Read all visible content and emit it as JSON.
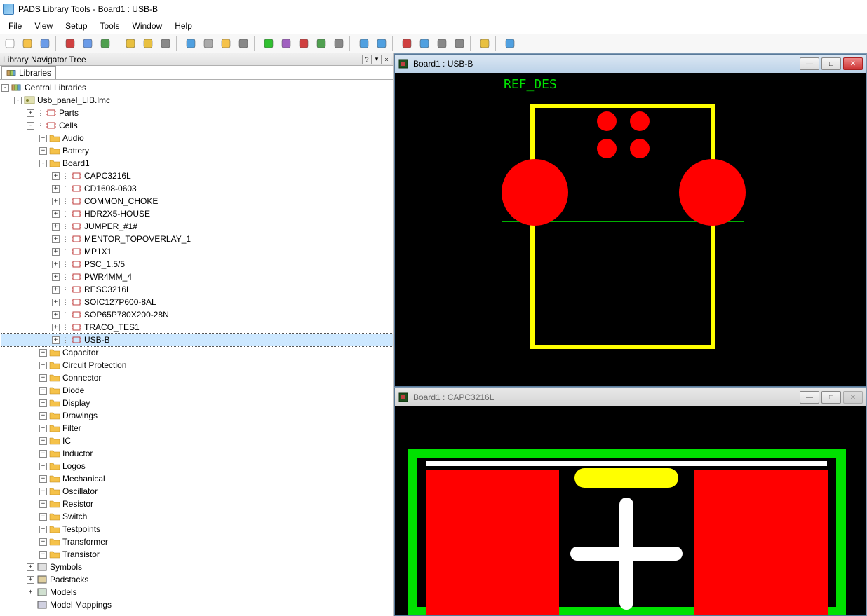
{
  "window_title": "PADS Library Tools - Board1 : USB-B",
  "menu": [
    "File",
    "View",
    "Setup",
    "Tools",
    "Window",
    "Help"
  ],
  "toolbar_icons": [
    "new",
    "open",
    "save",
    "sep",
    "prop-grid",
    "prop-text",
    "numeric",
    "sep",
    "edit-yellow",
    "edit-multi",
    "gear",
    "sep",
    "db-blue",
    "wrench",
    "stack",
    "grid",
    "sep",
    "green-circle",
    "purple",
    "db-red",
    "comp",
    "db-wrench",
    "sep",
    "undo",
    "redo",
    "sep",
    "window-red",
    "window-blue",
    "split",
    "cascade",
    "sep",
    "filter",
    "sep",
    "help"
  ],
  "panel_title": "Library Navigator Tree",
  "panel_controls": [
    "?",
    "▾",
    "×"
  ],
  "tab_label": "Libraries",
  "tree": {
    "root": "Central Libraries",
    "lib": "Usb_panel_LIB.lmc",
    "parts": "Parts",
    "cells": "Cells",
    "cell_folders_before": [
      "Audio",
      "Battery"
    ],
    "board1": "Board1",
    "board1_cells": [
      "CAPC3216L",
      "CD1608-0603",
      "COMMON_CHOKE",
      "HDR2X5-HOUSE",
      "JUMPER_#1#",
      "MENTOR_TOPOVERLAY_1",
      "MP1X1",
      "PSC_1.5/5",
      "PWR4MM_4",
      "RESC3216L",
      "SOIC127P600-8AL",
      "SOP65P780X200-28N",
      "TRACO_TES1",
      "USB-B"
    ],
    "cell_folders_after": [
      "Capacitor",
      "Circuit Protection",
      "Connector",
      "Diode",
      "Display",
      "Drawings",
      "Filter",
      "IC",
      "Inductor",
      "Logos",
      "Mechanical",
      "Oscillator",
      "Resistor",
      "Switch",
      "Testpoints",
      "Transformer",
      "Transistor"
    ],
    "symbols": "Symbols",
    "padstacks": "Padstacks",
    "models": "Models",
    "model_mappings": "Model Mappings"
  },
  "mdi": {
    "top_title": "Board1 : USB-B",
    "top_refdes": "REF_DES",
    "bot_title": "Board1 : CAPC3216L",
    "btn_min": "—",
    "btn_max": "□",
    "btn_close": "✕"
  }
}
